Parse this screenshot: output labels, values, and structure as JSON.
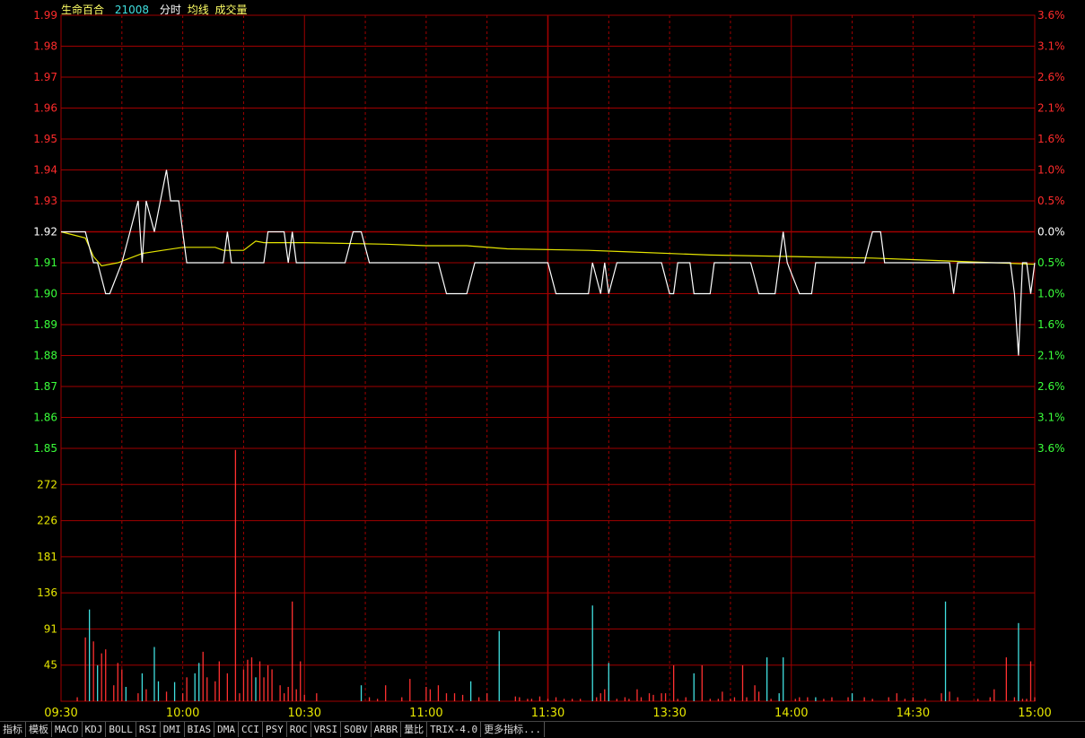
{
  "header": {
    "name": "生命百合",
    "code": "21008",
    "items": [
      "分时",
      "均线",
      "成交量"
    ]
  },
  "tabs": [
    "指标",
    "模板",
    "MACD",
    "KDJ",
    "BOLL",
    "RSI",
    "DMI",
    "BIAS",
    "DMA",
    "CCI",
    "PSY",
    "ROC",
    "VRSI",
    "SOBV",
    "ARBR",
    "量比",
    "TRIX-4.0",
    "更多指标..."
  ],
  "colors": {
    "grid": "#a00000",
    "price": "#ffffff",
    "avg": "#e6e600",
    "up": "#ff2b2b",
    "down": "#3aff3a",
    "vol_up": "#ff3030",
    "vol_down": "#40e0e0",
    "time_label": "#e6e600",
    "vol_label": "#e6e600"
  },
  "chart_data": {
    "type": "line",
    "prev_close": 1.92,
    "price_ticks": [
      "1.99",
      "1.98",
      "1.97",
      "1.96",
      "1.95",
      "1.94",
      "1.93",
      "1.92",
      "1.91",
      "1.90",
      "1.89",
      "1.88",
      "1.87",
      "1.86",
      "1.85"
    ],
    "pct_ticks": [
      "3.6%",
      "3.1%",
      "2.6%",
      "2.1%",
      "1.6%",
      "1.0%",
      "0.5%",
      "0.0%",
      "0.5%",
      "1.0%",
      "1.6%",
      "2.1%",
      "2.6%",
      "3.1%",
      "3.6%"
    ],
    "vol_ticks": [
      "272",
      "226",
      "181",
      "136",
      "91",
      "45"
    ],
    "time_labels": [
      "09:30",
      "10:00",
      "10:30",
      "11:00",
      "11:30",
      "13:30",
      "14:00",
      "14:30",
      "15:00"
    ],
    "total_minutes": 240,
    "price": [
      [
        0,
        1.92
      ],
      [
        6,
        1.92
      ],
      [
        8,
        1.91
      ],
      [
        9,
        1.91
      ],
      [
        11,
        1.9
      ],
      [
        12,
        1.9
      ],
      [
        15,
        1.91
      ],
      [
        17,
        1.92
      ],
      [
        19,
        1.93
      ],
      [
        20,
        1.91
      ],
      [
        21,
        1.93
      ],
      [
        23,
        1.92
      ],
      [
        26,
        1.94
      ],
      [
        27,
        1.93
      ],
      [
        29,
        1.93
      ],
      [
        31,
        1.91
      ],
      [
        35,
        1.91
      ],
      [
        40,
        1.91
      ],
      [
        41,
        1.92
      ],
      [
        42,
        1.91
      ],
      [
        45,
        1.91
      ],
      [
        50,
        1.91
      ],
      [
        51,
        1.92
      ],
      [
        55,
        1.92
      ],
      [
        56,
        1.91
      ],
      [
        57,
        1.92
      ],
      [
        58,
        1.91
      ],
      [
        60,
        1.91
      ],
      [
        70,
        1.91
      ],
      [
        72,
        1.92
      ],
      [
        74,
        1.92
      ],
      [
        76,
        1.91
      ],
      [
        80,
        1.91
      ],
      [
        85,
        1.91
      ],
      [
        90,
        1.91
      ],
      [
        93,
        1.91
      ],
      [
        95,
        1.9
      ],
      [
        100,
        1.9
      ],
      [
        102,
        1.91
      ],
      [
        110,
        1.91
      ],
      [
        112,
        1.91
      ],
      [
        120,
        1.91
      ],
      [
        122,
        1.9
      ],
      [
        130,
        1.9
      ],
      [
        131,
        1.91
      ],
      [
        133,
        1.9
      ],
      [
        134,
        1.91
      ],
      [
        135,
        1.9
      ],
      [
        137,
        1.91
      ],
      [
        140,
        1.91
      ],
      [
        148,
        1.91
      ],
      [
        150,
        1.9
      ],
      [
        151,
        1.9
      ],
      [
        152,
        1.91
      ],
      [
        155,
        1.91
      ],
      [
        156,
        1.9
      ],
      [
        160,
        1.9
      ],
      [
        161,
        1.91
      ],
      [
        165,
        1.91
      ],
      [
        170,
        1.91
      ],
      [
        172,
        1.9
      ],
      [
        176,
        1.9
      ],
      [
        177,
        1.91
      ],
      [
        178,
        1.92
      ],
      [
        179,
        1.91
      ],
      [
        182,
        1.9
      ],
      [
        185,
        1.9
      ],
      [
        186,
        1.91
      ],
      [
        190,
        1.91
      ],
      [
        198,
        1.91
      ],
      [
        200,
        1.92
      ],
      [
        202,
        1.92
      ],
      [
        203,
        1.91
      ],
      [
        210,
        1.91
      ],
      [
        218,
        1.91
      ],
      [
        219,
        1.91
      ],
      [
        220,
        1.9
      ],
      [
        221,
        1.91
      ],
      [
        225,
        1.91
      ],
      [
        234,
        1.91
      ],
      [
        235,
        1.9
      ],
      [
        236,
        1.88
      ],
      [
        237,
        1.91
      ],
      [
        238,
        1.91
      ],
      [
        239,
        1.9
      ],
      [
        240,
        1.91
      ]
    ],
    "avg_price": [
      [
        0,
        1.92
      ],
      [
        6,
        1.918
      ],
      [
        8,
        1.912
      ],
      [
        10,
        1.909
      ],
      [
        14,
        1.91
      ],
      [
        20,
        1.913
      ],
      [
        25,
        1.914
      ],
      [
        30,
        1.915
      ],
      [
        35,
        1.915
      ],
      [
        38,
        1.915
      ],
      [
        40,
        1.914
      ],
      [
        45,
        1.914
      ],
      [
        48,
        1.917
      ],
      [
        50,
        1.9165
      ],
      [
        60,
        1.9165
      ],
      [
        80,
        1.916
      ],
      [
        90,
        1.9155
      ],
      [
        100,
        1.9155
      ],
      [
        110,
        1.9145
      ],
      [
        130,
        1.914
      ],
      [
        140,
        1.9135
      ],
      [
        160,
        1.9125
      ],
      [
        200,
        1.9115
      ],
      [
        240,
        1.9095
      ]
    ],
    "volume": [
      {
        "t": 4,
        "v": 5,
        "d": "up"
      },
      {
        "t": 6,
        "v": 80,
        "d": "up"
      },
      {
        "t": 7,
        "v": 115,
        "d": "down"
      },
      {
        "t": 8,
        "v": 75,
        "d": "up"
      },
      {
        "t": 9,
        "v": 45,
        "d": "down"
      },
      {
        "t": 10,
        "v": 60,
        "d": "up"
      },
      {
        "t": 11,
        "v": 65,
        "d": "up"
      },
      {
        "t": 13,
        "v": 20,
        "d": "up"
      },
      {
        "t": 14,
        "v": 48,
        "d": "up"
      },
      {
        "t": 15,
        "v": 40,
        "d": "up"
      },
      {
        "t": 16,
        "v": 18,
        "d": "down"
      },
      {
        "t": 19,
        "v": 10,
        "d": "up"
      },
      {
        "t": 20,
        "v": 35,
        "d": "down"
      },
      {
        "t": 21,
        "v": 15,
        "d": "up"
      },
      {
        "t": 23,
        "v": 68,
        "d": "down"
      },
      {
        "t": 24,
        "v": 25,
        "d": "down"
      },
      {
        "t": 26,
        "v": 12,
        "d": "up"
      },
      {
        "t": 28,
        "v": 24,
        "d": "down"
      },
      {
        "t": 30,
        "v": 10,
        "d": "up"
      },
      {
        "t": 31,
        "v": 30,
        "d": "up"
      },
      {
        "t": 33,
        "v": 35,
        "d": "down"
      },
      {
        "t": 34,
        "v": 48,
        "d": "down"
      },
      {
        "t": 35,
        "v": 62,
        "d": "up"
      },
      {
        "t": 36,
        "v": 30,
        "d": "up"
      },
      {
        "t": 38,
        "v": 25,
        "d": "up"
      },
      {
        "t": 39,
        "v": 50,
        "d": "up"
      },
      {
        "t": 41,
        "v": 35,
        "d": "up"
      },
      {
        "t": 43,
        "v": 315,
        "d": "up"
      },
      {
        "t": 44,
        "v": 10,
        "d": "up"
      },
      {
        "t": 45,
        "v": 40,
        "d": "up"
      },
      {
        "t": 46,
        "v": 52,
        "d": "up"
      },
      {
        "t": 47,
        "v": 55,
        "d": "up"
      },
      {
        "t": 48,
        "v": 30,
        "d": "down"
      },
      {
        "t": 49,
        "v": 50,
        "d": "up"
      },
      {
        "t": 50,
        "v": 30,
        "d": "up"
      },
      {
        "t": 51,
        "v": 45,
        "d": "up"
      },
      {
        "t": 52,
        "v": 40,
        "d": "up"
      },
      {
        "t": 54,
        "v": 20,
        "d": "up"
      },
      {
        "t": 55,
        "v": 10,
        "d": "up"
      },
      {
        "t": 56,
        "v": 18,
        "d": "up"
      },
      {
        "t": 57,
        "v": 125,
        "d": "up"
      },
      {
        "t": 58,
        "v": 15,
        "d": "up"
      },
      {
        "t": 59,
        "v": 50,
        "d": "up"
      },
      {
        "t": 60,
        "v": 8,
        "d": "up"
      },
      {
        "t": 63,
        "v": 10,
        "d": "up"
      },
      {
        "t": 74,
        "v": 20,
        "d": "down"
      },
      {
        "t": 76,
        "v": 5,
        "d": "up"
      },
      {
        "t": 78,
        "v": 3,
        "d": "up"
      },
      {
        "t": 80,
        "v": 20,
        "d": "up"
      },
      {
        "t": 84,
        "v": 5,
        "d": "up"
      },
      {
        "t": 86,
        "v": 28,
        "d": "up"
      },
      {
        "t": 90,
        "v": 18,
        "d": "up"
      },
      {
        "t": 91,
        "v": 15,
        "d": "up"
      },
      {
        "t": 93,
        "v": 20,
        "d": "up"
      },
      {
        "t": 95,
        "v": 10,
        "d": "up"
      },
      {
        "t": 97,
        "v": 10,
        "d": "up"
      },
      {
        "t": 99,
        "v": 8,
        "d": "up"
      },
      {
        "t": 101,
        "v": 25,
        "d": "down"
      },
      {
        "t": 103,
        "v": 5,
        "d": "up"
      },
      {
        "t": 105,
        "v": 10,
        "d": "up"
      },
      {
        "t": 108,
        "v": 88,
        "d": "down"
      },
      {
        "t": 112,
        "v": 6,
        "d": "up"
      },
      {
        "t": 113,
        "v": 5,
        "d": "up"
      },
      {
        "t": 115,
        "v": 3,
        "d": "up"
      },
      {
        "t": 116,
        "v": 3,
        "d": "up"
      },
      {
        "t": 118,
        "v": 6,
        "d": "up"
      },
      {
        "t": 120,
        "v": 3,
        "d": "up"
      },
      {
        "t": 122,
        "v": 5,
        "d": "up"
      },
      {
        "t": 124,
        "v": 3,
        "d": "up"
      },
      {
        "t": 126,
        "v": 3,
        "d": "up"
      },
      {
        "t": 128,
        "v": 3,
        "d": "up"
      },
      {
        "t": 131,
        "v": 120,
        "d": "down"
      },
      {
        "t": 132,
        "v": 5,
        "d": "up"
      },
      {
        "t": 133,
        "v": 10,
        "d": "up"
      },
      {
        "t": 134,
        "v": 15,
        "d": "up"
      },
      {
        "t": 135,
        "v": 48,
        "d": "down"
      },
      {
        "t": 137,
        "v": 3,
        "d": "up"
      },
      {
        "t": 139,
        "v": 5,
        "d": "up"
      },
      {
        "t": 140,
        "v": 3,
        "d": "up"
      },
      {
        "t": 142,
        "v": 15,
        "d": "up"
      },
      {
        "t": 143,
        "v": 5,
        "d": "up"
      },
      {
        "t": 145,
        "v": 10,
        "d": "up"
      },
      {
        "t": 146,
        "v": 8,
        "d": "up"
      },
      {
        "t": 148,
        "v": 10,
        "d": "up"
      },
      {
        "t": 149,
        "v": 10,
        "d": "up"
      },
      {
        "t": 151,
        "v": 45,
        "d": "up"
      },
      {
        "t": 152,
        "v": 3,
        "d": "up"
      },
      {
        "t": 154,
        "v": 5,
        "d": "up"
      },
      {
        "t": 156,
        "v": 35,
        "d": "down"
      },
      {
        "t": 158,
        "v": 45,
        "d": "up"
      },
      {
        "t": 160,
        "v": 3,
        "d": "up"
      },
      {
        "t": 162,
        "v": 3,
        "d": "up"
      },
      {
        "t": 163,
        "v": 12,
        "d": "up"
      },
      {
        "t": 165,
        "v": 3,
        "d": "up"
      },
      {
        "t": 166,
        "v": 5,
        "d": "up"
      },
      {
        "t": 168,
        "v": 45,
        "d": "up"
      },
      {
        "t": 169,
        "v": 5,
        "d": "up"
      },
      {
        "t": 171,
        "v": 20,
        "d": "up"
      },
      {
        "t": 172,
        "v": 12,
        "d": "up"
      },
      {
        "t": 174,
        "v": 55,
        "d": "down"
      },
      {
        "t": 175,
        "v": 3,
        "d": "up"
      },
      {
        "t": 177,
        "v": 10,
        "d": "down"
      },
      {
        "t": 178,
        "v": 55,
        "d": "down"
      },
      {
        "t": 181,
        "v": 3,
        "d": "up"
      },
      {
        "t": 182,
        "v": 5,
        "d": "up"
      },
      {
        "t": 184,
        "v": 5,
        "d": "up"
      },
      {
        "t": 186,
        "v": 5,
        "d": "down"
      },
      {
        "t": 188,
        "v": 3,
        "d": "up"
      },
      {
        "t": 190,
        "v": 5,
        "d": "up"
      },
      {
        "t": 194,
        "v": 5,
        "d": "up"
      },
      {
        "t": 195,
        "v": 10,
        "d": "down"
      },
      {
        "t": 198,
        "v": 5,
        "d": "up"
      },
      {
        "t": 200,
        "v": 3,
        "d": "up"
      },
      {
        "t": 204,
        "v": 5,
        "d": "up"
      },
      {
        "t": 206,
        "v": 10,
        "d": "up"
      },
      {
        "t": 208,
        "v": 3,
        "d": "up"
      },
      {
        "t": 210,
        "v": 5,
        "d": "up"
      },
      {
        "t": 213,
        "v": 3,
        "d": "up"
      },
      {
        "t": 217,
        "v": 10,
        "d": "up"
      },
      {
        "t": 218,
        "v": 125,
        "d": "down"
      },
      {
        "t": 219,
        "v": 12,
        "d": "up"
      },
      {
        "t": 221,
        "v": 5,
        "d": "up"
      },
      {
        "t": 226,
        "v": 3,
        "d": "up"
      },
      {
        "t": 229,
        "v": 5,
        "d": "up"
      },
      {
        "t": 230,
        "v": 15,
        "d": "up"
      },
      {
        "t": 233,
        "v": 55,
        "d": "up"
      },
      {
        "t": 235,
        "v": 5,
        "d": "up"
      },
      {
        "t": 236,
        "v": 98,
        "d": "down"
      },
      {
        "t": 237,
        "v": 3,
        "d": "up"
      },
      {
        "t": 238,
        "v": 3,
        "d": "up"
      },
      {
        "t": 239,
        "v": 50,
        "d": "up"
      },
      {
        "t": 240,
        "v": 5,
        "d": "up"
      }
    ]
  }
}
